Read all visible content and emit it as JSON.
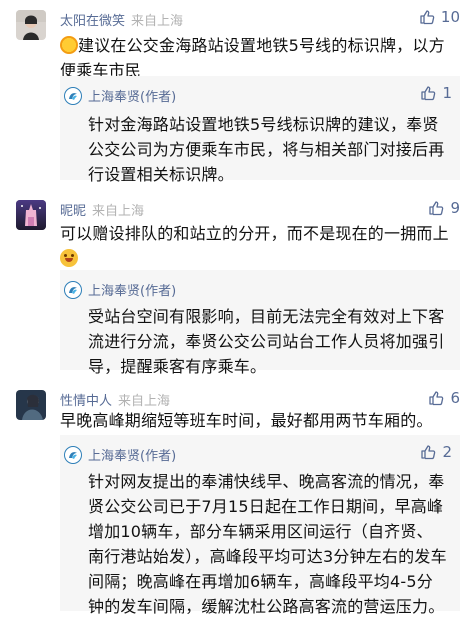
{
  "comments": [
    {
      "user": "太阳在微笑",
      "location": "来自上海",
      "likes": "10",
      "text": "建议在公交金海路站设置地铁5号线的标识牌，以方便乘车市民",
      "emoji": "sun",
      "reply": {
        "author": "上海奉贤(作者)",
        "likes": "1",
        "text": "针对金海路站设置地铁5号线标识牌的建议，奉贤公交公司为方便乘车市民，将与相关部门对接后再行设置相关标识牌。"
      }
    },
    {
      "user": "昵昵",
      "location": "来自上海",
      "likes": "9",
      "text": "可以赠设排队的和站立的分开，而不是现在的一拥而上",
      "emoji": "smile",
      "reply": {
        "author": "上海奉贤(作者)",
        "likes": "",
        "text": "受站台空间有限影响，目前无法完全有效对上下客流进行分流，奉贤公交公司站台工作人员将加强引导，提醒乘客有序乘车。"
      }
    },
    {
      "user": "性情中人",
      "location": "来自上海",
      "likes": "6",
      "text": "早晚高峰期缩短等班车时间，最好都用两节车厢的。",
      "emoji": "",
      "reply": {
        "author": "上海奉贤(作者)",
        "likes": "2",
        "text": "针对网友提出的奉浦快线早、晚高客流的情况，奉贤公交公司已于7月15日起在工作日期间，早高峰增加10辆车，部分车辆采用区间运行（自齐贤、南行港站始发），高峰段平均可达3分钟左右的发车间隔；晚高峰在再增加6辆车，高峰段平均4-5分钟的发车间隔，缓解沈杜公路高客流的营运压力。"
      }
    }
  ],
  "colors": {
    "link": "#576b95",
    "muted": "#b2b2b2",
    "reply_bg": "#f6f6f6"
  }
}
